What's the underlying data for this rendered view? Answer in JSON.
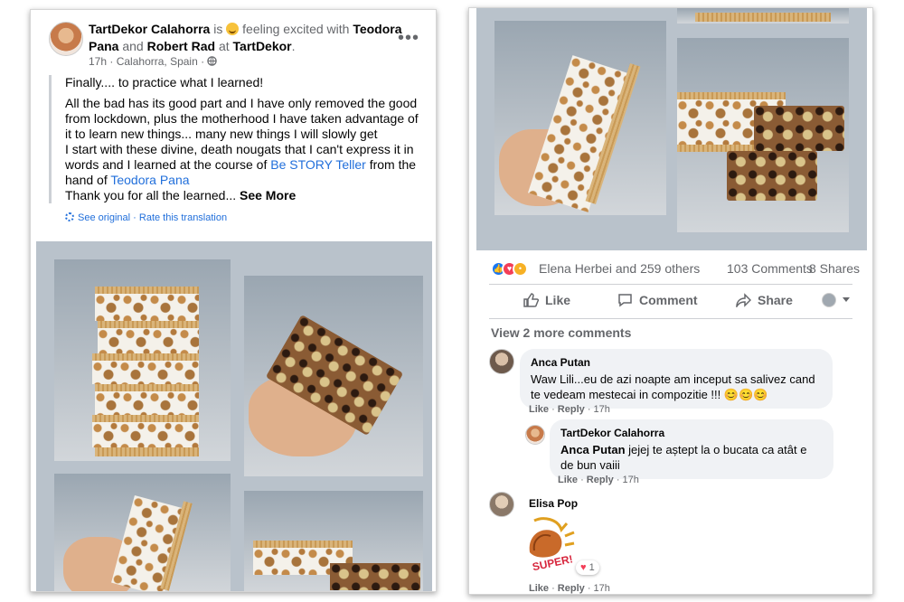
{
  "post": {
    "author": "TartDekor Calahorra",
    "is_text": "is",
    "feeling": "feeling excited with",
    "tag1": "Teodora",
    "tag1b": "Pana",
    "and_text": "and",
    "tag2": "Robert Rad",
    "at_text": "at",
    "place": "TartDekor",
    "period": ".",
    "time": "17h",
    "location": "Calahorra, Spain",
    "p1": "Finally.... to practice what I learned!",
    "p2a": "All the bad has its good part and I have only removed the good from lockdown, plus the motherhood I have taken advantage of it to learn new things... many new things I will slowly get",
    "p2b": "I start with these divine, death nougats that I can't express it in words and I learned at the course of",
    "course_link": "Be STORY Teller",
    "p2c": "from the hand of",
    "teacher_link": "Teodora Pana",
    "p3": "Thank you for all the learned...",
    "see_more": "See More",
    "see_original": "See original",
    "sep": "·",
    "rate_translation": "Rate this translation"
  },
  "stats": {
    "reactors": "Elena Herbei and 259 others",
    "comments": "103 Comments",
    "shares": "8 Shares"
  },
  "actions": {
    "like": "Like",
    "comment": "Comment",
    "share": "Share"
  },
  "view_more": "View 2 more comments",
  "comments": [
    {
      "name": "Anca Putan",
      "text": "Waw Lili...eu de azi noapte am inceput sa salivez cand te vedeam mestecai in compozitie !!! 😊😊😊",
      "like": "Like",
      "reply": "Reply",
      "time": "17h"
    },
    {
      "name": "TartDekor Calahorra",
      "mention": "Anca Putan",
      "text": "jejej te aștept la o bucata ca atât e de bun vaiii",
      "like": "Like",
      "reply": "Reply",
      "time": "17h"
    },
    {
      "name": "Elisa Pop",
      "sticker_text": "SUPER!",
      "heart_count": "1",
      "like": "Like",
      "reply": "Reply",
      "time": "17h"
    }
  ],
  "colors": {
    "link": "#216fdb",
    "like_blue": "#1877f2",
    "love_red": "#f33e58",
    "wow_yellow": "#f7b125"
  },
  "icons": [
    "more-options-icon",
    "globe-icon",
    "gear-icon",
    "like-icon",
    "comment-icon",
    "share-icon",
    "dropdown-icon"
  ]
}
